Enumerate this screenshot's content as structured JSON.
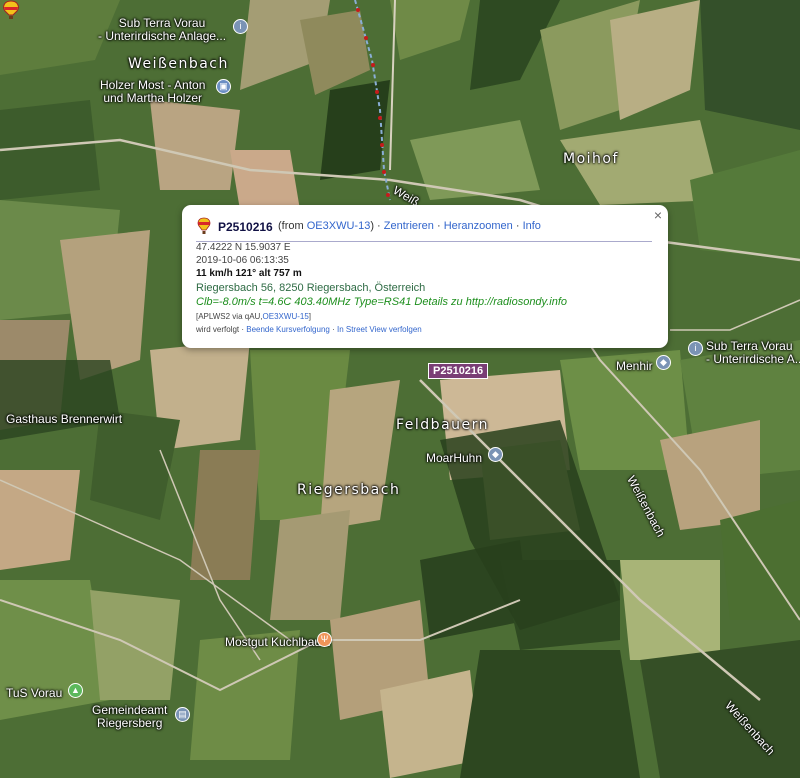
{
  "map": {
    "area_labels": [
      "Weißenbach",
      "Moihof",
      "Feldbauern",
      "Riegersbach"
    ],
    "road_labels": [
      "Weißenbach",
      "Weißenbach",
      "Weiß"
    ],
    "pois": [
      {
        "line1": "Sub Terra Vorau",
        "line2": "- Unterirdische Anlage...",
        "icon": "info-pin-icon"
      },
      {
        "line1": "Holzer Most - Anton",
        "line2": "und Martha Holzer",
        "icon": "shop-pin-icon"
      },
      {
        "line1": "Sub Terra Vorau",
        "line2": "- Unterirdische A...",
        "icon": "info-pin-icon"
      },
      {
        "line1": "Menhir",
        "line2": "",
        "icon": "landmark-pin-icon"
      },
      {
        "line1": "Gasthaus Brennerwirt",
        "line2": "",
        "icon": ""
      },
      {
        "line1": "MoarHuhn",
        "line2": "",
        "icon": "landmark-pin-icon"
      },
      {
        "line1": "Mostgut Kuchlbauer",
        "line2": "",
        "icon": "food-pin-icon"
      },
      {
        "line1": "TuS Vorau",
        "line2": "",
        "icon": "park-pin-icon"
      },
      {
        "line1": "Gemeindeamt",
        "line2": "Riegersberg",
        "icon": "building-pin-icon"
      }
    ],
    "colors": {
      "poi_blue": "#7a93b5",
      "poi_food": "#f0955a",
      "poi_park": "#5cb85c",
      "track": "#c61b1b",
      "balloon_label": "#7a3e75"
    }
  },
  "marker": {
    "callsign": "P2510216",
    "icon": "balloon-icon"
  },
  "popup": {
    "callsign": "P2510216",
    "from_prefix": "(from ",
    "from_call": "OE3XWU-13",
    "from_suffix": ")",
    "sep": " · ",
    "links": [
      "Zentrieren",
      "Heranzoomen",
      "Info"
    ],
    "coords": "47.4222 N 15.9037 E",
    "time": "2019-10-06 06:13:35",
    "speed": "11 km/h 121° alt 757 m",
    "address": "Riegersbach 56, 8250 Riegersbach, Österreich",
    "comment": "Clb=-8.0m/s t=4.6C 403.40MHz Type=RS41 Details zu http://radiosondy.info",
    "path_prefix": "[APLWS2 via qAU,",
    "path_call": "OE3XWU-15",
    "path_suffix": "]",
    "followed": "wird verfolgt",
    "follow_links": [
      "Beende Kursverfolgung",
      "In Street View verfolgen"
    ],
    "close": "×"
  }
}
